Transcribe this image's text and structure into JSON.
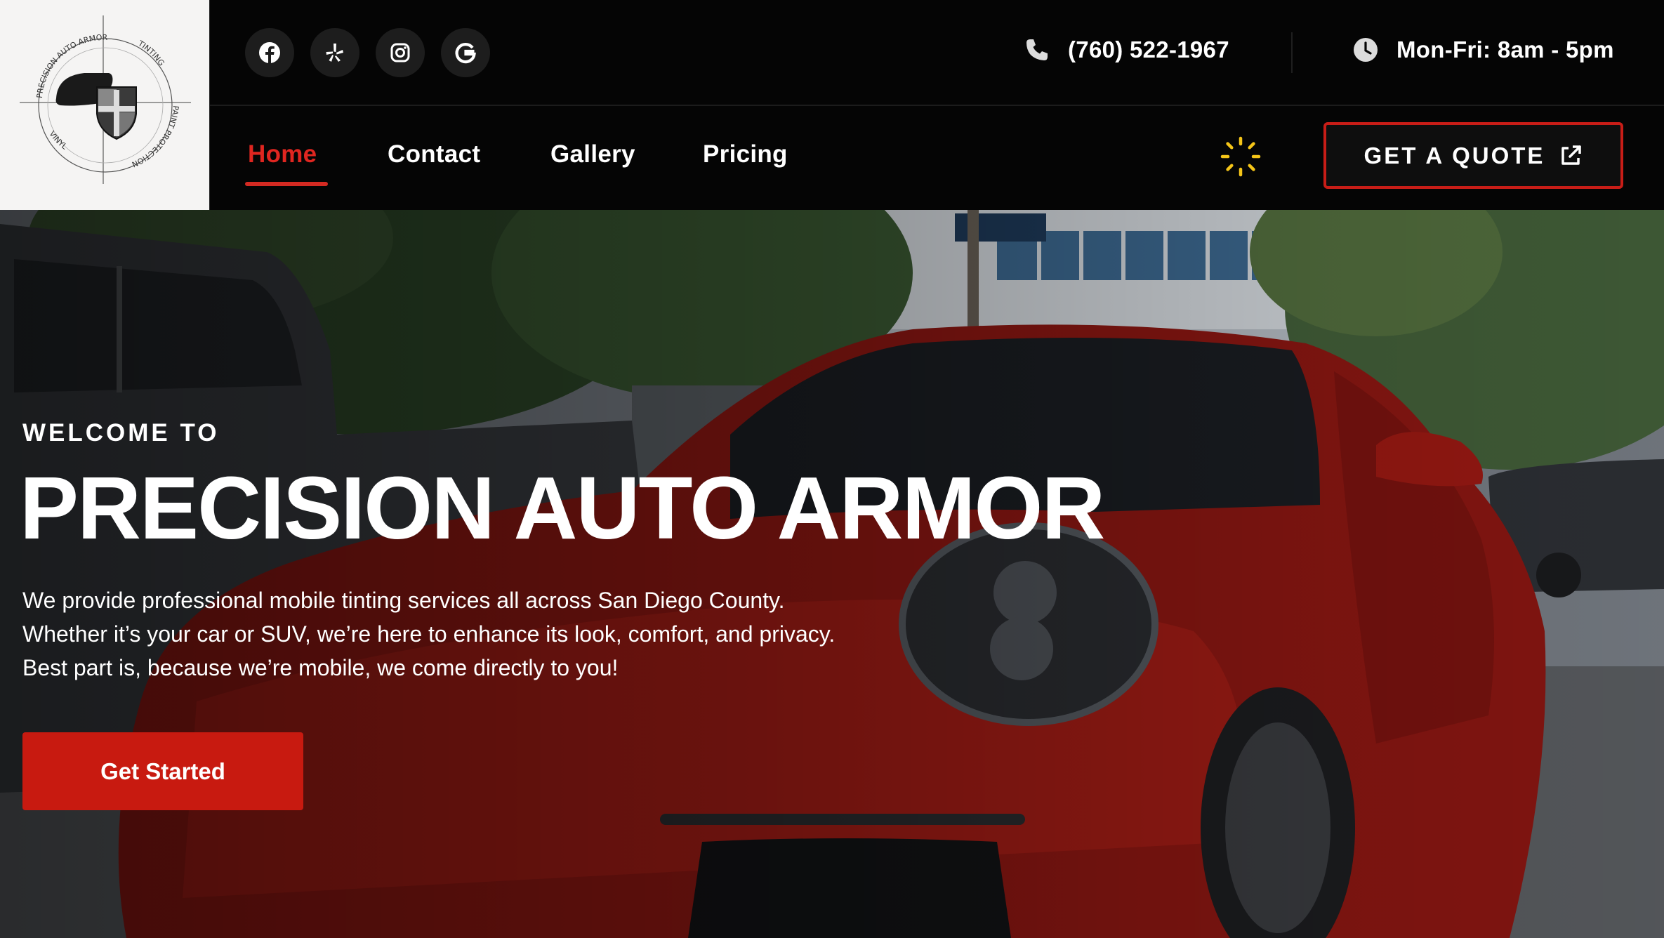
{
  "logo": {
    "alt": "Precision Auto Armor logo",
    "ring_text_top": "PRECISION AUTO ARMOR",
    "ring_text_right": "TINTING",
    "ring_text_bottom_right": "PAINT PROTECTION",
    "ring_text_bottom_left": "VINYL"
  },
  "social": [
    {
      "name": "facebook",
      "icon": "facebook-icon"
    },
    {
      "name": "yelp",
      "icon": "yelp-icon"
    },
    {
      "name": "instagram",
      "icon": "instagram-icon"
    },
    {
      "name": "google",
      "icon": "google-icon"
    }
  ],
  "contact": {
    "phone": "(760) 522-1967",
    "hours": "Mon-Fri: 8am - 5pm"
  },
  "nav": {
    "items": [
      {
        "label": "Home",
        "active": true
      },
      {
        "label": "Contact",
        "active": false
      },
      {
        "label": "Gallery",
        "active": false
      },
      {
        "label": "Pricing",
        "active": false
      }
    ],
    "quote_label": "GET A QUOTE"
  },
  "hero": {
    "eyebrow": "WELCOME TO",
    "title": "PRECISION AUTO ARMOR",
    "description": [
      "We provide professional mobile tinting services all across San Diego County.",
      "Whether it’s your car or SUV, we’re here to enhance its look, comfort, and privacy.",
      "Best part is, because we’re mobile, we come directly to you!"
    ],
    "cta_label": "Get Started"
  },
  "colors": {
    "accent": "#c81a10",
    "active_nav": "#e02620",
    "header_bg": "#050505",
    "spinner": "#f5c518"
  }
}
